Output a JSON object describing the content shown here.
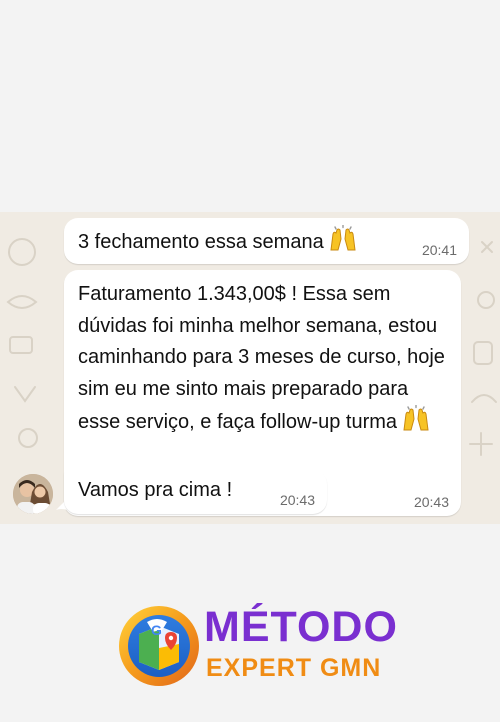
{
  "messages": [
    {
      "text": "3 fechamento essa semana",
      "time": "20:41",
      "emoji": "raising-hands-icon"
    },
    {
      "text": "Faturamento 1.343,00$ ! Essa sem dúvidas foi minha melhor semana, estou caminhando para 3 meses de curso, hoje sim eu me sinto mais preparado para esse serviço, e faça follow-up turma",
      "time": "20:43",
      "emoji": "raising-hands-icon"
    },
    {
      "text": "Vamos pra cima !",
      "time": "20:43"
    }
  ],
  "brand": {
    "title": "MÉTODO",
    "subtitle": "EXPERT GMN",
    "title_color": "#7a2fd0",
    "subtitle_color": "#f08c14"
  },
  "colors": {
    "chat_background": "#f0ebe3",
    "bubble": "#ffffff",
    "page_background": "#f3f3f3"
  }
}
